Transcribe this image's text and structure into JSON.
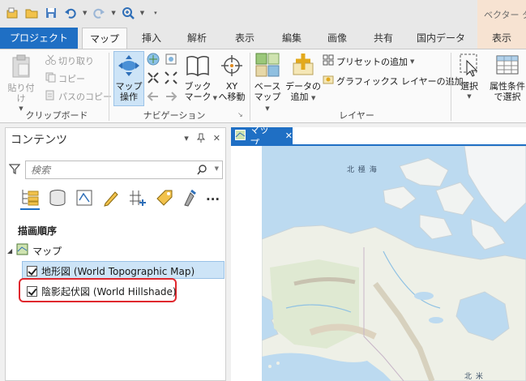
{
  "colors": {
    "accent": "#1f6fc4",
    "selection": "#cde4f7",
    "highlight_box": "#e0282e",
    "context_tab": "#f7e3d2"
  },
  "qat": {
    "icons": [
      "new-project-icon",
      "open-icon",
      "save-icon",
      "undo-icon",
      "redo-icon",
      "zoom-icon",
      "customize-icon"
    ]
  },
  "context_title": "ベクター タイ",
  "tabs": {
    "project": "プロジェクト",
    "map": "マップ",
    "insert": "挿入",
    "analysis": "解析",
    "view": "表示",
    "edit": "編集",
    "imagery": "画像",
    "share": "共有",
    "japan_data": "国内データ",
    "ctx_view": "表示"
  },
  "clipboard": {
    "paste": "貼り付け",
    "cut": "切り取り",
    "copy": "コピー",
    "copy_path": "パスのコピー",
    "label": "クリップボード"
  },
  "navigation": {
    "explore_line1": "マップ",
    "explore_line2": "操作",
    "bookmarks_line1": "ブック",
    "bookmarks_line2": "マーク",
    "goto_line1": "XY",
    "goto_line2": "へ移動",
    "label": "ナビゲーション"
  },
  "layer": {
    "basemap_line1": "ベース",
    "basemap_line2": "マップ",
    "add_data_line1": "データの",
    "add_data_line2": "追加",
    "add_preset": "プリセットの追加",
    "add_graphics": "グラフィックス レイヤーの追加",
    "label": "レイヤー"
  },
  "selection": {
    "select": "選択",
    "by_attr_line1": "属性条件",
    "by_attr_line2": "で選択"
  },
  "contents": {
    "title": "コンテンツ",
    "search_placeholder": "検索",
    "draw_order": "描画順序",
    "map_name": "マップ",
    "layers": [
      {
        "name": "地形図 (World Topographic Map)",
        "checked": true,
        "selected": true
      },
      {
        "name": "陰影起伏図 (World Hillshade)",
        "checked": true,
        "selected": false,
        "highlighted": true
      }
    ]
  },
  "mapview": {
    "tab_label": "マップ",
    "labels": {
      "arctic": "北 極 海",
      "north_america": "北 米"
    }
  }
}
